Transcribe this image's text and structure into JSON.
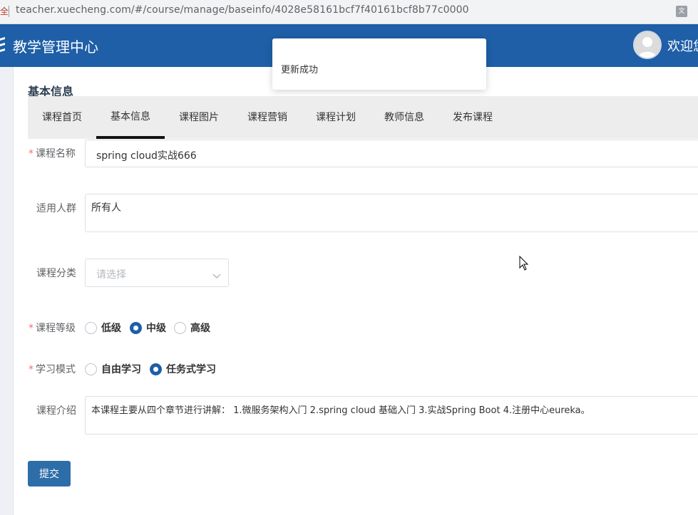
{
  "browser": {
    "url_prefix": "全",
    "url": "teacher.xuecheng.com/#/course/manage/baseinfo/4028e58161bcf7f40161bcf8b77c0000",
    "translate_icon": "translate-icon"
  },
  "header": {
    "title": "教学管理中心",
    "welcome": "欢迎您",
    "brand_color": "#1e5fa7"
  },
  "toast": {
    "message": "更新成功"
  },
  "section": {
    "title": "基本信息"
  },
  "tabs": [
    {
      "label": "课程首页",
      "active": false
    },
    {
      "label": "基本信息",
      "active": true
    },
    {
      "label": "课程图片",
      "active": false
    },
    {
      "label": "课程营销",
      "active": false
    },
    {
      "label": "课程计划",
      "active": false
    },
    {
      "label": "教师信息",
      "active": false
    },
    {
      "label": "发布课程",
      "active": false
    }
  ],
  "form": {
    "name": {
      "label": "课程名称",
      "required": true,
      "value": "spring cloud实战666"
    },
    "audience": {
      "label": "适用人群",
      "required": false,
      "value": "所有人"
    },
    "category": {
      "label": "课程分类",
      "required": false,
      "placeholder": "请选择"
    },
    "grade": {
      "label": "课程等级",
      "required": true,
      "options": [
        {
          "label": "低级",
          "selected": false
        },
        {
          "label": "中级",
          "selected": true
        },
        {
          "label": "高级",
          "selected": false
        }
      ]
    },
    "mode": {
      "label": "学习模式",
      "required": true,
      "options": [
        {
          "label": "自由学习",
          "selected": false
        },
        {
          "label": "任务式学习",
          "selected": true
        }
      ]
    },
    "intro": {
      "label": "课程介绍",
      "required": false,
      "value": "本课程主要从四个章节进行讲解： 1.微服务架构入门 2.spring cloud 基础入门 3.实战Spring Boot 4.注册中心eureka。"
    },
    "submit_label": "提交"
  }
}
